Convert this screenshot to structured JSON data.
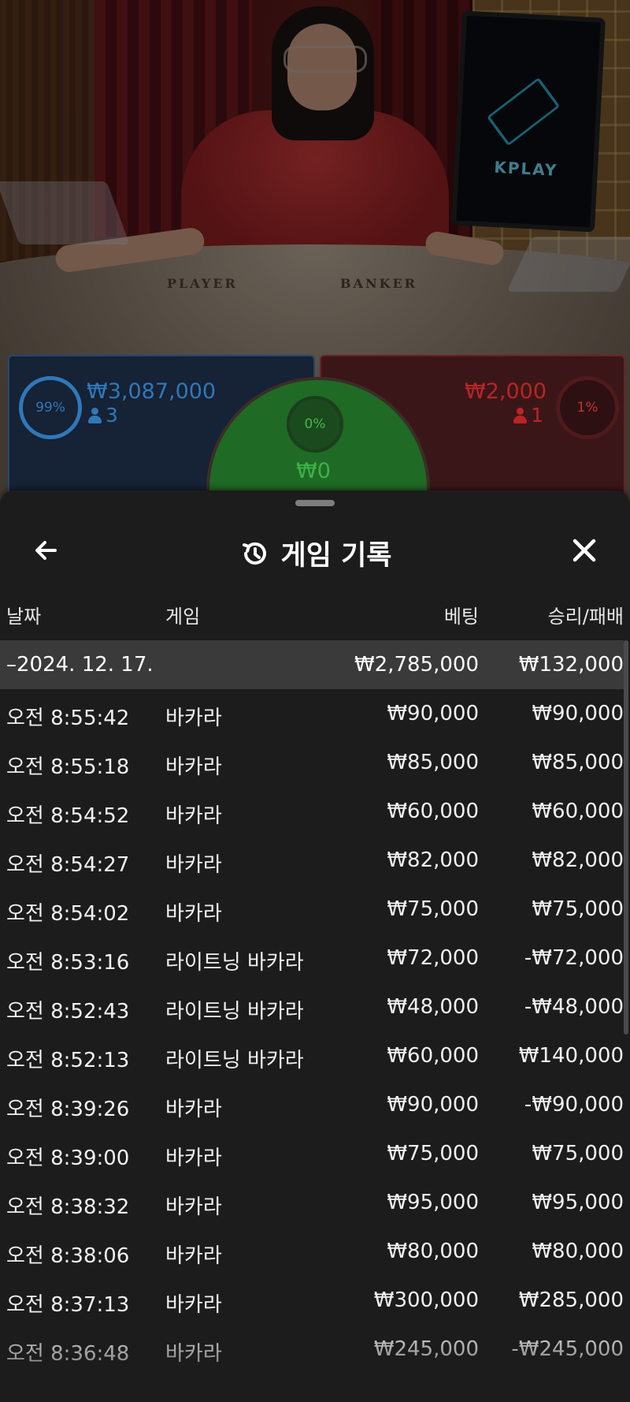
{
  "video": {
    "player_label": "PLAYER",
    "banker_label": "BANKER",
    "monitor_brand": "KPLAY"
  },
  "bets": {
    "player": {
      "percent": "99%",
      "amount": "₩3,087,000",
      "count": "3"
    },
    "banker": {
      "percent": "1%",
      "amount": "₩2,000",
      "count": "1"
    },
    "tie": {
      "percent": "0%",
      "amount": "₩0"
    }
  },
  "sheet": {
    "title": "게임 기록",
    "icons": {
      "back": "arrow-left-icon",
      "history": "history-icon",
      "close": "close-icon"
    },
    "columns": {
      "date": "날짜",
      "game": "게임",
      "bet": "베팅",
      "result": "승리/패배"
    },
    "day": {
      "label": "–2024. 12. 17.",
      "bet": "₩2,785,000",
      "result": "₩132,000"
    },
    "rows": [
      {
        "time": "오전 8:55:42",
        "game": "바카라",
        "bet": "₩90,000",
        "result": "₩90,000"
      },
      {
        "time": "오전 8:55:18",
        "game": "바카라",
        "bet": "₩85,000",
        "result": "₩85,000"
      },
      {
        "time": "오전 8:54:52",
        "game": "바카라",
        "bet": "₩60,000",
        "result": "₩60,000"
      },
      {
        "time": "오전 8:54:27",
        "game": "바카라",
        "bet": "₩82,000",
        "result": "₩82,000"
      },
      {
        "time": "오전 8:54:02",
        "game": "바카라",
        "bet": "₩75,000",
        "result": "₩75,000"
      },
      {
        "time": "오전 8:53:16",
        "game": "라이트닝 바카라",
        "bet": "₩72,000",
        "result": "-₩72,000"
      },
      {
        "time": "오전 8:52:43",
        "game": "라이트닝 바카라",
        "bet": "₩48,000",
        "result": "-₩48,000"
      },
      {
        "time": "오전 8:52:13",
        "game": "라이트닝 바카라",
        "bet": "₩60,000",
        "result": "₩140,000"
      },
      {
        "time": "오전 8:39:26",
        "game": "바카라",
        "bet": "₩90,000",
        "result": "-₩90,000"
      },
      {
        "time": "오전 8:39:00",
        "game": "바카라",
        "bet": "₩75,000",
        "result": "₩75,000"
      },
      {
        "time": "오전 8:38:32",
        "game": "바카라",
        "bet": "₩95,000",
        "result": "₩95,000"
      },
      {
        "time": "오전 8:38:06",
        "game": "바카라",
        "bet": "₩80,000",
        "result": "₩80,000"
      },
      {
        "time": "오전 8:37:13",
        "game": "바카라",
        "bet": "₩300,000",
        "result": "₩285,000"
      },
      {
        "time": "오전 8:36:48",
        "game": "바카라",
        "bet": "₩245,000",
        "result": "-₩245,000"
      }
    ]
  }
}
